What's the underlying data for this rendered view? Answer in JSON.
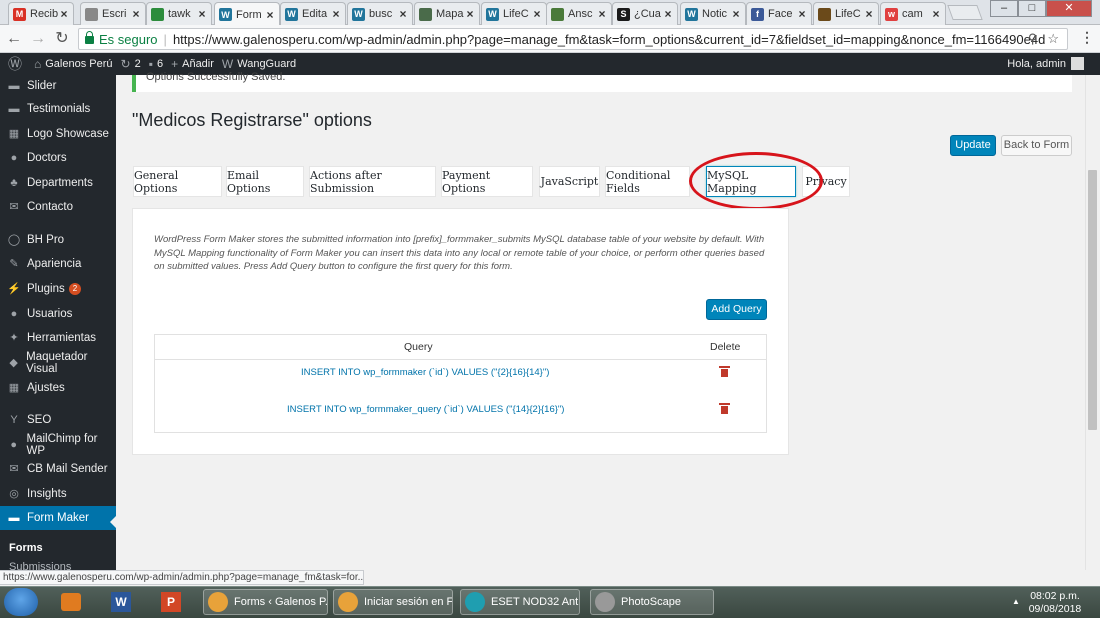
{
  "browser": {
    "tabs": [
      {
        "title": "Recib",
        "icon": "gmail-icon",
        "color": "#d93025",
        "glyph": "M"
      },
      {
        "title": "Escri",
        "icon": "page-icon",
        "color": "#888888",
        "glyph": ""
      },
      {
        "title": "tawk",
        "icon": "tawk-icon",
        "color": "#2c8c3c",
        "glyph": ""
      },
      {
        "title": "Form",
        "icon": "wordpress-icon",
        "color": "#21759b",
        "glyph": "W",
        "active": true
      },
      {
        "title": "Edita",
        "icon": "wordpress-icon",
        "color": "#21759b",
        "glyph": "W"
      },
      {
        "title": "busc",
        "icon": "wordpress-icon",
        "color": "#21759b",
        "glyph": "W"
      },
      {
        "title": "Mapa",
        "icon": "map-icon",
        "color": "#4a6b4a",
        "glyph": ""
      },
      {
        "title": "LifeC",
        "icon": "wordpress-icon",
        "color": "#21759b",
        "glyph": "W"
      },
      {
        "title": "Ansc",
        "icon": "ansc-icon",
        "color": "#4a7a3a",
        "glyph": ""
      },
      {
        "title": "¿Cua",
        "icon": "sep-icon",
        "color": "#1a1a1a",
        "glyph": "S"
      },
      {
        "title": "Notic",
        "icon": "wordpress-icon",
        "color": "#21759b",
        "glyph": "W"
      },
      {
        "title": "Face",
        "icon": "facebook-icon",
        "color": "#3b5998",
        "glyph": "f"
      },
      {
        "title": "LifeC",
        "icon": "lifec-icon",
        "color": "#6b4a1a",
        "glyph": ""
      },
      {
        "title": "cam",
        "icon": "cam-icon",
        "color": "#e04040",
        "glyph": "w"
      }
    ],
    "secure_label": "Es seguro",
    "url": "https://www.galenosperu.com/wp-admin/admin.php?page=manage_fm&task=form_options&current_id=7&fieldset_id=mapping&nonce_fm=1166490e4d",
    "status_url": "https://www.galenosperu.com/wp-admin/admin.php?page=manage_fm&task=for..."
  },
  "adminbar": {
    "site_name": "Galenos Perú",
    "updates_count": "2",
    "comments_count": "6",
    "add_label": "Añadir",
    "wangguard_label": "WangGuard",
    "howdy": "Hola, admin"
  },
  "sidebar": {
    "items": [
      {
        "label": "Slider",
        "icon": "slider-icon",
        "glyph": "▬"
      },
      {
        "label": "Testimonials",
        "icon": "testimonials-icon",
        "glyph": "▬"
      },
      {
        "label": "Logo Showcase",
        "icon": "grid-icon",
        "glyph": "▦"
      },
      {
        "label": "Doctors",
        "icon": "user-icon",
        "glyph": "●"
      },
      {
        "label": "Departments",
        "icon": "departments-icon",
        "glyph": "♣"
      },
      {
        "label": "Contacto",
        "icon": "mail-icon",
        "glyph": "✉"
      },
      {
        "label": "BH Pro",
        "icon": "bh-icon",
        "glyph": "◯"
      },
      {
        "label": "Apariencia",
        "icon": "brush-icon",
        "glyph": "✎"
      },
      {
        "label": "Plugins",
        "icon": "plugin-icon",
        "glyph": "⚡",
        "badge": "2"
      },
      {
        "label": "Usuarios",
        "icon": "users-icon",
        "glyph": "●"
      },
      {
        "label": "Herramientas",
        "icon": "wrench-icon",
        "glyph": "✦"
      },
      {
        "label": "Maquetador Visual",
        "icon": "visual-icon",
        "glyph": "◆"
      },
      {
        "label": "Ajustes",
        "icon": "settings-icon",
        "glyph": "▦"
      },
      {
        "label": "SEO",
        "icon": "seo-icon",
        "glyph": "Y"
      },
      {
        "label": "MailChimp for WP",
        "icon": "mailchimp-icon",
        "glyph": "●"
      },
      {
        "label": "CB Mail Sender",
        "icon": "mail-icon",
        "glyph": "✉"
      },
      {
        "label": "Insights",
        "icon": "insights-icon",
        "glyph": "◎"
      },
      {
        "label": "Form Maker",
        "icon": "formmaker-icon",
        "glyph": "▬",
        "active": true
      }
    ],
    "submenu_forms": "Forms",
    "submenu_submissions": "Submissions"
  },
  "main": {
    "notice": "Options Successfully Saved.",
    "title": "\"Medicos Registrarse\" options",
    "update_label": "Update",
    "back_label": "Back to Form",
    "tabs": [
      {
        "label": "General Options"
      },
      {
        "label": "Email Options"
      },
      {
        "label": "Actions after Submission"
      },
      {
        "label": "Payment Options"
      },
      {
        "label": "JavaScript"
      },
      {
        "label": "Conditional Fields"
      },
      {
        "label": "MySQL Mapping",
        "active": true
      },
      {
        "label": "Privacy"
      }
    ],
    "description": "WordPress Form Maker stores the submitted information into [prefix]_formmaker_submits MySQL database table of your website by default. With MySQL Mapping functionality of Form Maker you can insert this data into any local or remote table of your choice, or perform other queries based on submitted values. Press Add Query button to configure the first query for this form.",
    "add_query_label": "Add Query",
    "table": {
      "col_query": "Query",
      "col_delete": "Delete",
      "rows": [
        "INSERT INTO wp_formmaker (`id`) VALUES (\"{2}{16}{14}\")",
        "INSERT INTO wp_formmaker_query (`id`) VALUES (\"{14}{2}{16}\")"
      ]
    }
  },
  "taskbar": {
    "tasks": [
      {
        "label": "Forms ‹ Galenos P...",
        "icon": "chrome-icon",
        "color": "#e8a23a"
      },
      {
        "label": "Iniciar sesión en F...",
        "icon": "chrome-icon",
        "color": "#e8a23a"
      },
      {
        "label": "ESET NOD32 Anti...",
        "icon": "eset-icon",
        "color": "#1f9eb0"
      },
      {
        "label": "PhotoScape",
        "icon": "photoscape-icon",
        "color": "#999999"
      }
    ],
    "time": "08:02 p.m.",
    "date": "09/08/2018"
  },
  "colors": {
    "accent": "#0085ba",
    "sidebar": "#23282d",
    "highlight": "#d7141b"
  }
}
